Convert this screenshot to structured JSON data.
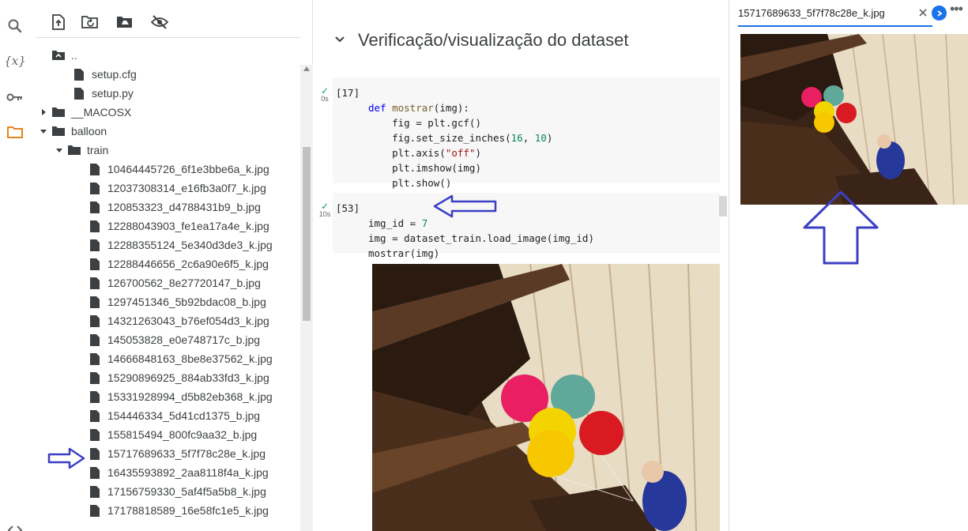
{
  "rail": {
    "icons": [
      "search-icon",
      "variables-icon",
      "key-icon",
      "folder-icon",
      "code-icon"
    ],
    "active_color": "#e37400"
  },
  "file_toolbar": {
    "icons": [
      "upload-file-icon",
      "refresh-folder-icon",
      "mount-drive-icon",
      "hide-files-icon"
    ]
  },
  "tree": {
    "parent_label": "..",
    "rows": [
      {
        "label": "setup.cfg",
        "type": "file",
        "depth": 2
      },
      {
        "label": "setup.py",
        "type": "file",
        "depth": 2
      },
      {
        "label": "__MACOSX",
        "type": "folder-collapsed",
        "depth": 1
      },
      {
        "label": "balloon",
        "type": "folder-open",
        "depth": 1
      },
      {
        "label": "train",
        "type": "folder-open",
        "depth": 2
      },
      {
        "label": "10464445726_6f1e3bbe6a_k.jpg",
        "type": "file",
        "depth": 3
      },
      {
        "label": "12037308314_e16fb3a0f7_k.jpg",
        "type": "file",
        "depth": 3
      },
      {
        "label": "120853323_d4788431b9_b.jpg",
        "type": "file",
        "depth": 3
      },
      {
        "label": "12288043903_fe1ea17a4e_k.jpg",
        "type": "file",
        "depth": 3
      },
      {
        "label": "12288355124_5e340d3de3_k.jpg",
        "type": "file",
        "depth": 3
      },
      {
        "label": "12288446656_2c6a90e6f5_k.jpg",
        "type": "file",
        "depth": 3
      },
      {
        "label": "126700562_8e27720147_b.jpg",
        "type": "file",
        "depth": 3
      },
      {
        "label": "1297451346_5b92bdac08_b.jpg",
        "type": "file",
        "depth": 3
      },
      {
        "label": "14321263043_b76ef054d3_k.jpg",
        "type": "file",
        "depth": 3
      },
      {
        "label": "145053828_e0e748717c_b.jpg",
        "type": "file",
        "depth": 3
      },
      {
        "label": "14666848163_8be8e37562_k.jpg",
        "type": "file",
        "depth": 3
      },
      {
        "label": "15290896925_884ab33fd3_k.jpg",
        "type": "file",
        "depth": 3
      },
      {
        "label": "15331928994_d5b82eb368_k.jpg",
        "type": "file",
        "depth": 3
      },
      {
        "label": "154446334_5d41cd1375_b.jpg",
        "type": "file",
        "depth": 3
      },
      {
        "label": "155815494_800fc9aa32_b.jpg",
        "type": "file",
        "depth": 3
      },
      {
        "label": "15717689633_5f7f78c28e_k.jpg",
        "type": "file",
        "depth": 3
      },
      {
        "label": "16435593892_2aa8118f4a_k.jpg",
        "type": "file",
        "depth": 3
      },
      {
        "label": "17156759330_5af4f5a5b8_k.jpg",
        "type": "file",
        "depth": 3
      },
      {
        "label": "17178818589_16e58fc1e5_k.jpg",
        "type": "file",
        "depth": 3
      }
    ]
  },
  "notebook": {
    "section_title": "Verificação/visualização do dataset",
    "cell1": {
      "exec": "[17]",
      "time": "0s",
      "lines": [
        [
          "def",
          " ",
          "mostrar",
          "(img):"
        ],
        [
          "    fig = plt.gcf()"
        ],
        [
          "    fig.set_size_inches(",
          "16",
          ", ",
          "10",
          ")"
        ],
        [
          "    plt.axis(",
          "\"off\"",
          ")"
        ],
        [
          "    plt.imshow(img)"
        ],
        [
          "    plt.show()"
        ]
      ]
    },
    "cell2": {
      "exec": "[53]",
      "time": "10s",
      "line1_pre": "img_id = ",
      "line1_num": "7",
      "line2": "img = dataset_train.load_image(img_id)",
      "line3": "mostrar(img)"
    }
  },
  "viewer": {
    "tab_title": "15717689633_5f7f78c28e_k.jpg",
    "more_label": "•••"
  },
  "colors": {
    "accent": "#1a73e8",
    "annotation": "#3b3fc4",
    "keyword": "#0000ff",
    "function": "#795e26",
    "number": "#098658",
    "string": "#a31515",
    "success": "#0f9d58"
  }
}
